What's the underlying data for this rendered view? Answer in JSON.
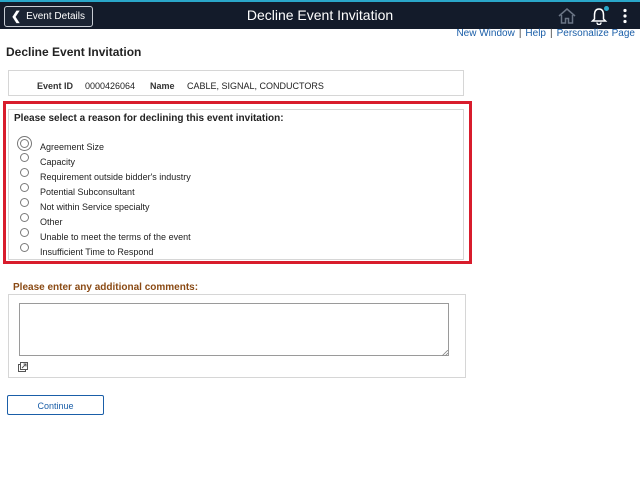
{
  "header": {
    "back_label": "Event Details",
    "title": "Decline Event Invitation",
    "icons": [
      "home-icon",
      "bell-icon",
      "menu-icon"
    ],
    "accent_color": "#2aa7c9",
    "bar_color": "#131b2a"
  },
  "links": {
    "new_window": "New Window",
    "help": "Help",
    "personalize": "Personalize Page",
    "separator": "|"
  },
  "page_title": "Decline Event Invitation",
  "event": {
    "id_label": "Event ID",
    "id_value": "0000426064",
    "name_label": "Name",
    "name_value": "CABLE, SIGNAL, CONDUCTORS"
  },
  "reasons": {
    "title": "Please select a reason for declining this event invitation:",
    "highlight_color": "#d81c2c",
    "options": [
      "Agreement Size",
      "Capacity",
      "Requirement outside bidder's industry",
      "Potential Subconsultant",
      "Not within Service specialty",
      "Other",
      "Unable to meet the terms of the event",
      "Insufficient Time to Respond"
    ]
  },
  "comments": {
    "label": "Please enter any additional comments:",
    "value": ""
  },
  "continue_label": "Continue"
}
